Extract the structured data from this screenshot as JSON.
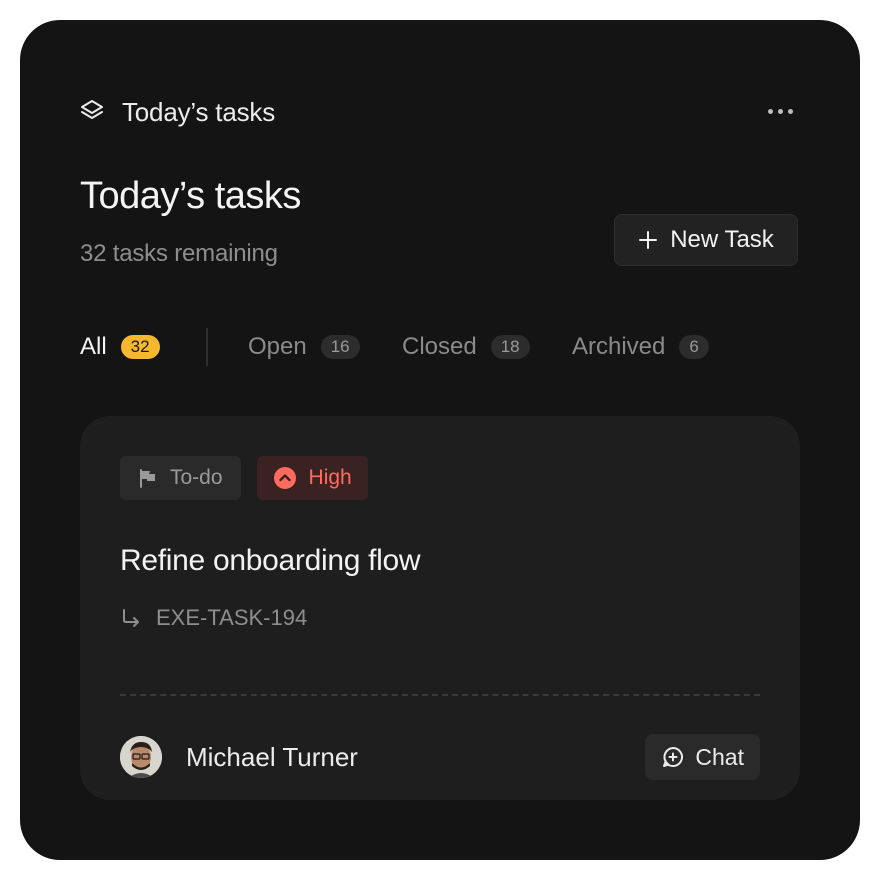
{
  "header": {
    "icon": "layers-icon",
    "title": "Today’s tasks",
    "more_icon": "more-horizontal-icon"
  },
  "main": {
    "heading": "Today’s tasks",
    "subheading": "32 tasks remaining",
    "new_task": {
      "icon": "plus-icon",
      "label": "New Task"
    }
  },
  "tabs": [
    {
      "label": "All",
      "count": "32",
      "active": true
    },
    {
      "label": "Open",
      "count": "16",
      "active": false
    },
    {
      "label": "Closed",
      "count": "18",
      "active": false
    },
    {
      "label": "Archived",
      "count": "6",
      "active": false
    }
  ],
  "task": {
    "status": {
      "icon": "flag-icon",
      "label": "To-do"
    },
    "priority": {
      "icon": "chevron-up-circle-icon",
      "label": "High",
      "color": "#ff6b5e"
    },
    "title": "Refine onboarding flow",
    "id_icon": "return-arrow-icon",
    "id": "EXE-TASK-194",
    "assignee": {
      "name": "Michael Turner",
      "avatar": "avatar"
    },
    "chat": {
      "icon": "chat-plus-icon",
      "label": "Chat"
    }
  },
  "colors": {
    "background": "#141414",
    "card": "#1e1e1e",
    "accent": "#f7b82d",
    "priority_high": "#ff6b5e"
  }
}
